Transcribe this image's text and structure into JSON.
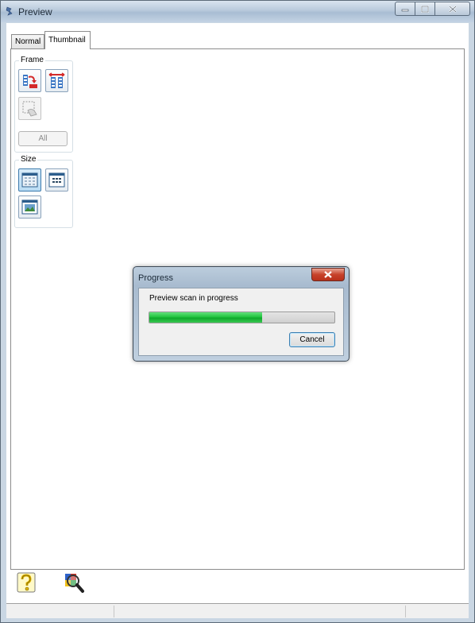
{
  "window": {
    "title": "Preview",
    "controls": {
      "minimize": "minimize-icon",
      "maximize": "maximize-icon",
      "close": "close-icon"
    }
  },
  "tabs": [
    {
      "label": "Normal",
      "selected": false
    },
    {
      "label": "Thumbnail",
      "selected": true
    }
  ],
  "frame_group": {
    "legend": "Frame",
    "buttons": [
      "auto-locate-icon",
      "delete-frame-icon",
      "marquee-icon"
    ],
    "all_label": "All",
    "all_enabled": false
  },
  "size_group": {
    "legend": "Size",
    "buttons": [
      "small-thumbnails-icon",
      "medium-thumbnails-icon",
      "large-thumbnail-icon"
    ],
    "selected": "small-thumbnails-icon"
  },
  "bottom": {
    "help_icon": "help-icon",
    "scan_icon": "magnifier-icon"
  },
  "progress_dialog": {
    "title": "Progress",
    "message": "Preview scan in progress",
    "progress_fraction": 0.61,
    "cancel_label": "Cancel"
  },
  "colors": {
    "progress_green": "#22c43f",
    "dialog_close_red": "#c7422a",
    "frame_border": "#5c6a78"
  }
}
